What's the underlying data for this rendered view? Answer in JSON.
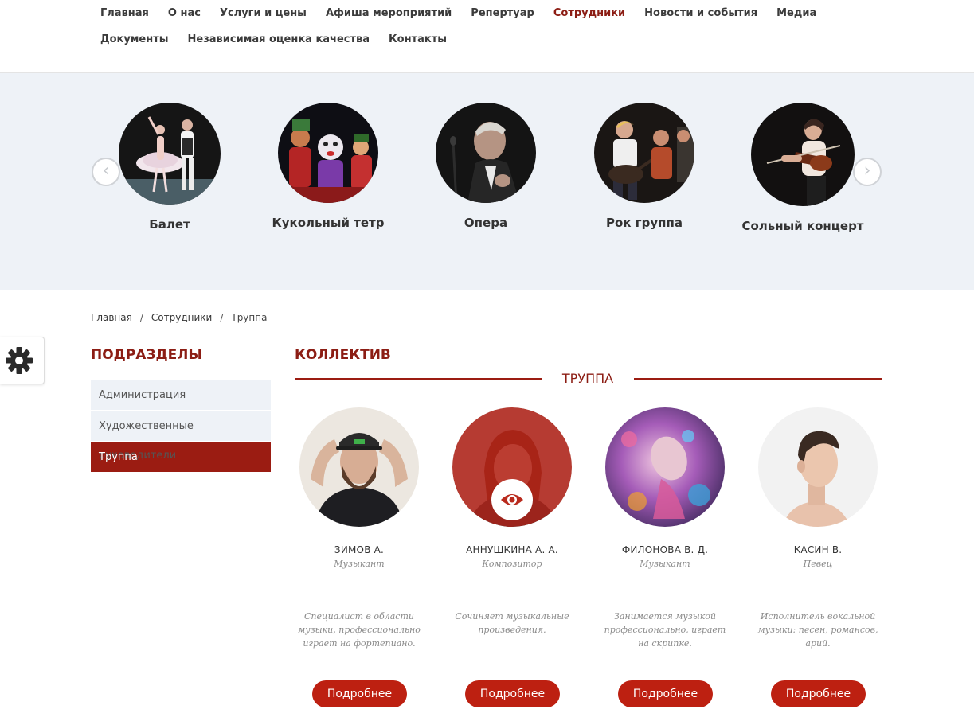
{
  "nav": {
    "items": [
      {
        "label": "Главная",
        "active": false
      },
      {
        "label": "О нас",
        "active": false
      },
      {
        "label": "Услуги и цены",
        "active": false
      },
      {
        "label": "Афиша мероприятий",
        "active": false
      },
      {
        "label": "Репертуар",
        "active": false
      },
      {
        "label": "Сотрудники",
        "active": true
      },
      {
        "label": "Новости и события",
        "active": false
      },
      {
        "label": "Медиа",
        "active": false
      },
      {
        "label": "Документы",
        "active": false
      },
      {
        "label": "Независимая оценка качества",
        "active": false
      },
      {
        "label": "Контакты",
        "active": false
      }
    ],
    "active_color": "#8c1d14"
  },
  "carousel": {
    "prev_icon": "chevron-left-icon",
    "next_icon": "chevron-right-icon",
    "items": [
      {
        "label": "Балет",
        "image": "ballet-dancers-photo"
      },
      {
        "label": "Кукольный тетр",
        "image": "puppets-photo"
      },
      {
        "label": "Опера",
        "image": "opera-singer-photo"
      },
      {
        "label": "Рок группа",
        "image": "rock-band-photo"
      },
      {
        "label": "Сольный концерт",
        "image": "violinist-photo"
      }
    ]
  },
  "breadcrumb": {
    "items": [
      "Главная",
      "Сотрудники",
      "Труппа"
    ],
    "separator": "/"
  },
  "settings": {
    "icon": "gear-icon"
  },
  "sidebar": {
    "title": "ПОДРАЗДЕЛЫ",
    "items": [
      {
        "label": "Администрация",
        "active": false
      },
      {
        "label": "Художественные руководители",
        "active": false
      },
      {
        "label": "Труппа",
        "active": true
      }
    ]
  },
  "main": {
    "title": "КОЛЛЕКТИВ",
    "section": "ТРУППА",
    "people": [
      {
        "name": "Зимов А.",
        "role": "Музыкант",
        "desc": "Специалист в области музыки, профессионально играет на фортепиано.",
        "button": "Подробнее",
        "hovered": false
      },
      {
        "name": "Аннушкина А. А.",
        "role": "Композитор",
        "desc": "Сочиняет музыкальные произведения.",
        "button": "Подробнее",
        "hovered": true
      },
      {
        "name": "Филонова В. Д.",
        "role": "Музыкант",
        "desc": "Занимается музыкой профессионально, играет на скрипке.",
        "button": "Подробнее",
        "hovered": false
      },
      {
        "name": "Касин В.",
        "role": "Певец",
        "desc": "Исполнитель вокальной музыки: песен, романсов, арий.",
        "button": "Подробнее",
        "hovered": false
      }
    ]
  },
  "colors": {
    "accent": "#9b1c12",
    "button": "#bd2011",
    "panel_bg": "#eef2f7"
  }
}
